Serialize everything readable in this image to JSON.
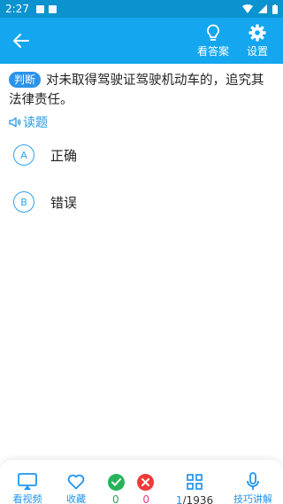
{
  "status": {
    "time": "2:27"
  },
  "appbar": {
    "answer_label": "看答案",
    "settings_label": "设置"
  },
  "question": {
    "tag": "判断",
    "text": "对未取得驾驶证驾驶机动车的，追究其法律责任。",
    "read_label": "读题"
  },
  "options": [
    {
      "letter": "A",
      "label": "正确"
    },
    {
      "letter": "B",
      "label": "错误"
    }
  ],
  "bottombar": {
    "video_label": "看视频",
    "fav_label": "收藏",
    "correct_count": "0",
    "wrong_count": "0",
    "current": "1",
    "separator_total": "/1936",
    "tips_label": "技巧讲解"
  },
  "colors": {
    "appbar": "#14a6ee",
    "statusbar": "#0b93cf",
    "accent": "#2094ee",
    "correct": "#27b35a",
    "wrong": "#ef3a3a"
  }
}
